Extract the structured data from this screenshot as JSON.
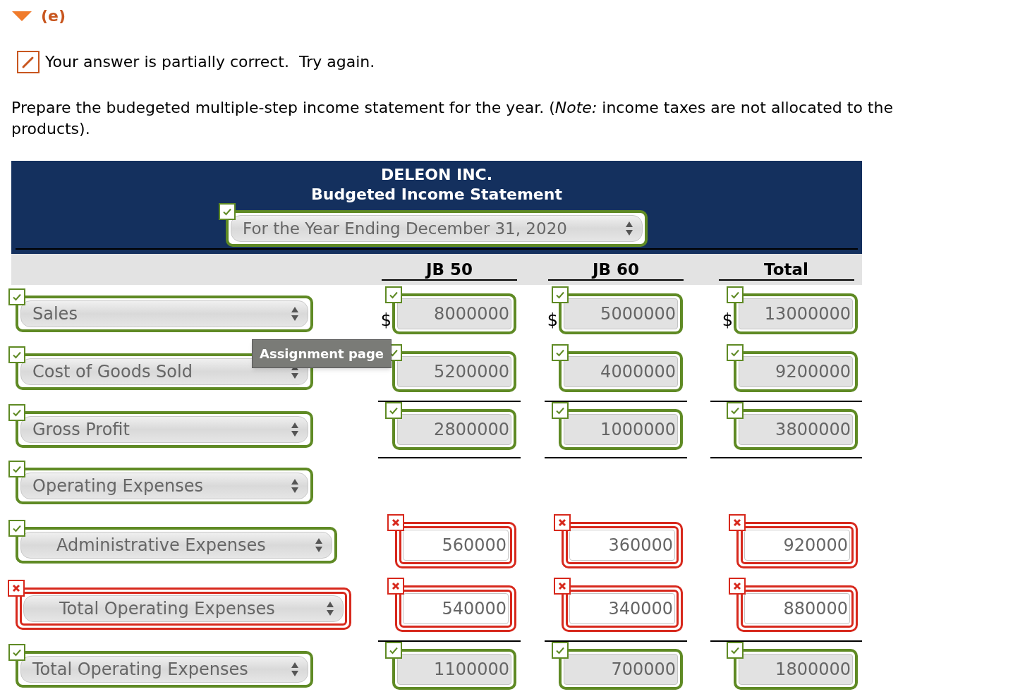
{
  "part": {
    "label": "(e)",
    "expanded": true
  },
  "feedback": {
    "text": "Your answer is partially correct.  Try again."
  },
  "instructions": "Prepare the budegeted multiple-step income statement for the year. (*Note:* income taxes are not allocated to the products).",
  "statement": {
    "company": "DELEON INC.",
    "title": "Budgeted Income Statement",
    "period": {
      "value": "For the Year Ending December 31, 2020",
      "correct": true
    },
    "columns": [
      "JB 50",
      "JB 60",
      "Total"
    ],
    "rows": [
      {
        "kind": "line",
        "label": {
          "value": "Sales",
          "correct": true,
          "indented": false
        },
        "cells": [
          {
            "dollar": "$",
            "value": "8000000",
            "correct": true
          },
          {
            "dollar": "$",
            "value": "5000000",
            "correct": true
          },
          {
            "dollar": "$",
            "value": "13000000",
            "correct": true
          }
        ]
      },
      {
        "kind": "line",
        "label": {
          "value": "Cost of Goods Sold",
          "correct": true,
          "indented": false
        },
        "cells": [
          {
            "value": "5200000",
            "correct": true
          },
          {
            "value": "4000000",
            "correct": true
          },
          {
            "value": "9200000",
            "correct": true
          }
        ]
      },
      {
        "kind": "subtotal",
        "label": {
          "value": "Gross Profit",
          "correct": true,
          "indented": false
        },
        "cells": [
          {
            "value": "2800000",
            "correct": true
          },
          {
            "value": "1000000",
            "correct": true
          },
          {
            "value": "3800000",
            "correct": true
          }
        ]
      },
      {
        "kind": "heading",
        "label": {
          "value": "Operating Expenses",
          "correct": true,
          "indented": false
        }
      },
      {
        "kind": "line",
        "label": {
          "value": "Administrative Expenses",
          "correct": true,
          "indented": true
        },
        "cells": [
          {
            "value": "560000",
            "correct": false
          },
          {
            "value": "360000",
            "correct": false
          },
          {
            "value": "920000",
            "correct": false
          }
        ]
      },
      {
        "kind": "line",
        "label": {
          "value": "Total Operating Expenses",
          "correct": false,
          "indented": true
        },
        "cells": [
          {
            "value": "540000",
            "correct": false
          },
          {
            "value": "340000",
            "correct": false
          },
          {
            "value": "880000",
            "correct": false
          }
        ]
      },
      {
        "kind": "subtotal",
        "label": {
          "value": "Total Operating Expenses",
          "correct": true,
          "indented": false
        },
        "cells": [
          {
            "value": "1100000",
            "correct": true
          },
          {
            "value": "700000",
            "correct": true
          },
          {
            "value": "1800000",
            "correct": true
          }
        ]
      }
    ]
  },
  "tooltip": "Assignment page"
}
